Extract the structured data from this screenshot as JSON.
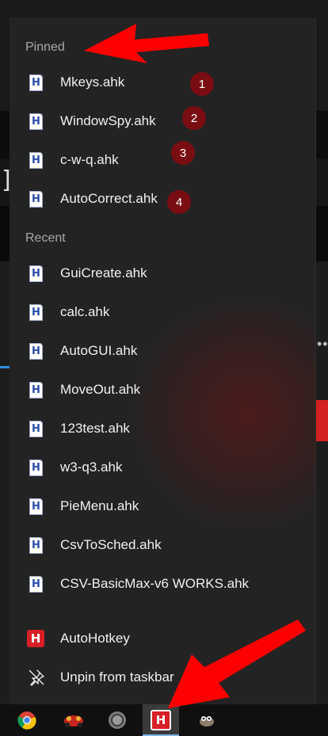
{
  "jumplist": {
    "pinned_label": "Pinned",
    "recent_label": "Recent",
    "pinned": [
      {
        "label": "Mkeys.ahk",
        "badge": "1"
      },
      {
        "label": "WindowSpy.ahk",
        "badge": "2"
      },
      {
        "label": "c-w-q.ahk",
        "badge": "3"
      },
      {
        "label": "AutoCorrect.ahk",
        "badge": "4"
      }
    ],
    "recent": [
      {
        "label": "GuiCreate.ahk"
      },
      {
        "label": "calc.ahk"
      },
      {
        "label": "AutoGUI.ahk"
      },
      {
        "label": "MoveOut.ahk"
      },
      {
        "label": "123test.ahk"
      },
      {
        "label": "w3-q3.ahk"
      },
      {
        "label": "PieMenu.ahk"
      },
      {
        "label": "CsvToSched.ahk"
      },
      {
        "label": "CSV-BasicMax-v6 WORKS.ahk"
      }
    ],
    "app_label": "AutoHotkey",
    "unpin_label": "Unpin from taskbar",
    "file_icon_letter": "H",
    "app_icon_letter": "H"
  },
  "taskbar": {
    "apps": [
      {
        "icon": "chrome-icon"
      },
      {
        "icon": "racing-app-icon"
      },
      {
        "icon": "circle-app-icon"
      },
      {
        "icon": "autohotkey-icon",
        "active": true
      },
      {
        "icon": "gimp-icon"
      }
    ]
  },
  "colors": {
    "badge": "#7a0d12",
    "arrow": "#ff0000",
    "ahk_red": "#d81f26",
    "file_h_blue": "#2b4ea8"
  }
}
